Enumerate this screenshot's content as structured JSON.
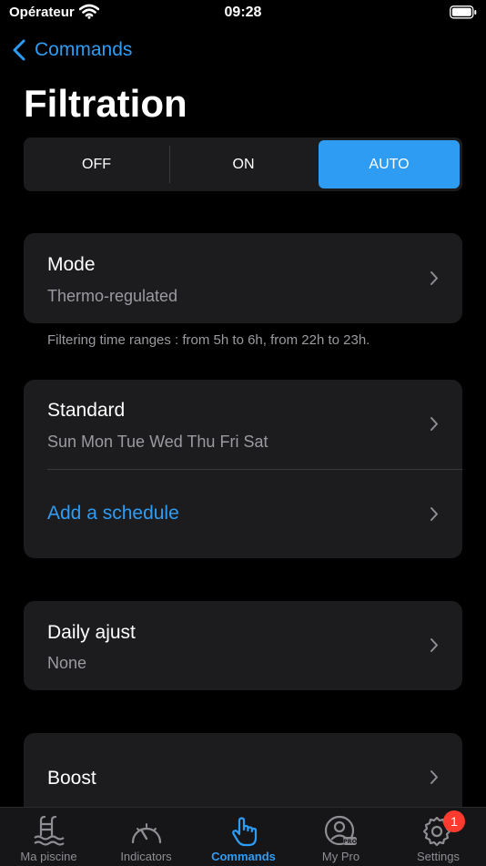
{
  "status_bar": {
    "carrier": "Opérateur",
    "time": "09:28"
  },
  "nav": {
    "back_label": "Commands"
  },
  "page": {
    "title": "Filtration"
  },
  "segmented": {
    "off": "OFF",
    "on": "ON",
    "auto": "AUTO",
    "selected": "AUTO"
  },
  "mode_card": {
    "title": "Mode",
    "subtitle": "Thermo-regulated"
  },
  "footnote": "Filtering time ranges : from 5h to 6h, from 22h to 23h.",
  "schedule_card": {
    "standard_title": "Standard",
    "standard_days": "Sun Mon Tue Wed Thu Fri Sat",
    "add_label": "Add a schedule"
  },
  "daily_card": {
    "title": "Daily ajust",
    "subtitle": "None"
  },
  "boost_card": {
    "title": "Boost"
  },
  "tabs": [
    {
      "label": "Ma piscine",
      "icon": "pool-icon"
    },
    {
      "label": "Indicators",
      "icon": "gauge-icon"
    },
    {
      "label": "Commands",
      "icon": "hand-pointer-icon",
      "active": true
    },
    {
      "label": "My Pro",
      "icon": "pro-avatar-icon"
    },
    {
      "label": "Settings",
      "icon": "gear-icon",
      "badge": "1"
    }
  ],
  "colors": {
    "accent": "#2f9cf3",
    "card": "#1c1c1e",
    "background": "#000000",
    "secondary_text": "#9a9aa0",
    "badge": "#ff3b30"
  }
}
